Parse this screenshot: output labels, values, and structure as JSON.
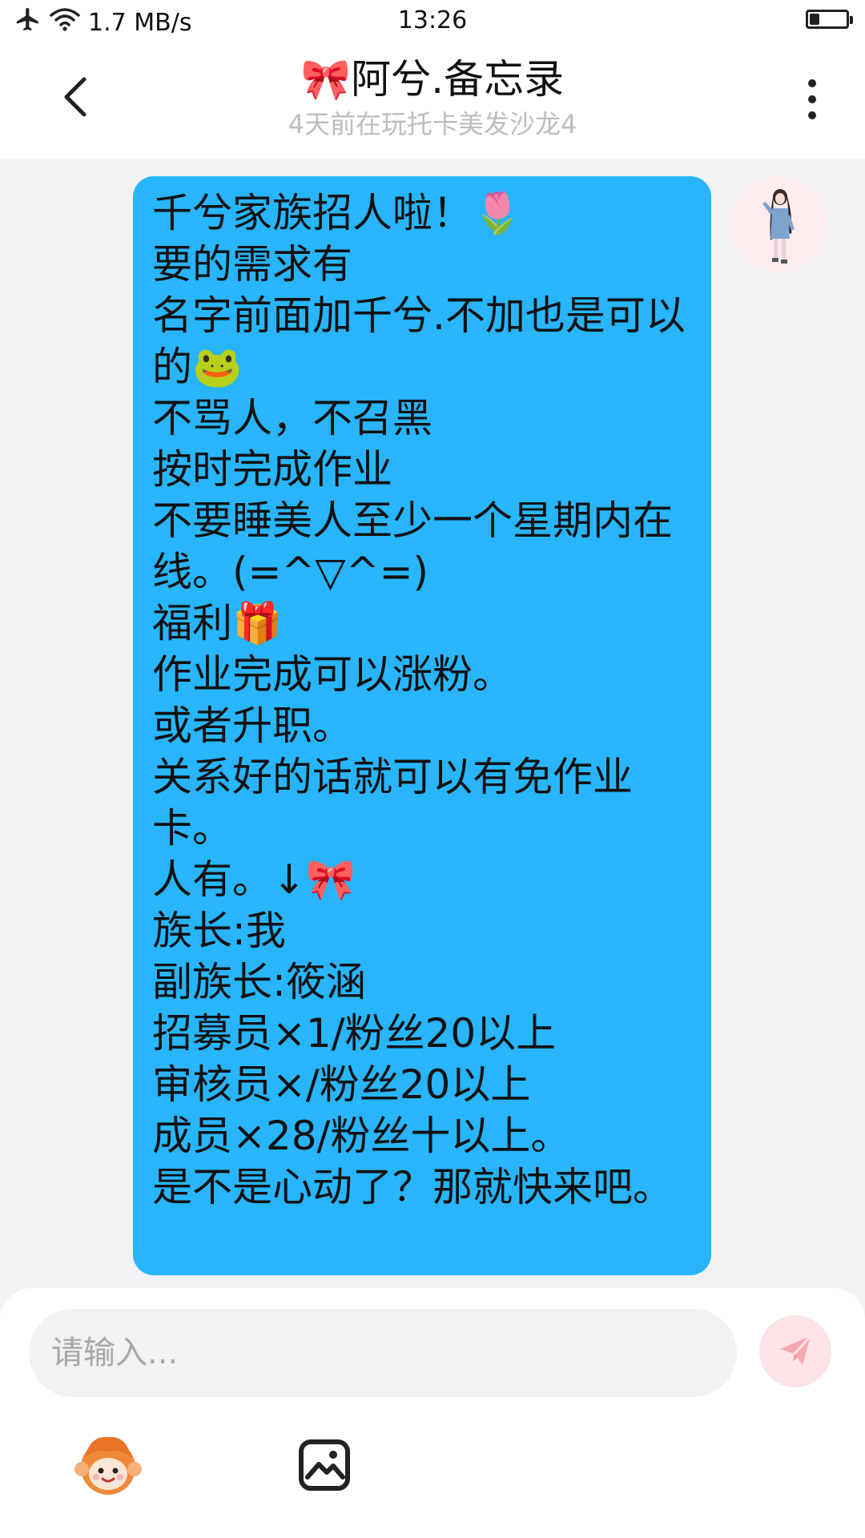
{
  "status_bar": {
    "network_speed": "1.7 MB/s",
    "time": "13:26"
  },
  "header": {
    "title": "🎀阿兮.备忘录",
    "subtitle": "4天前在玩托卡美发沙龙4"
  },
  "message": {
    "text": "千兮家族招人啦！🌷\n要的需求有\n名字前面加千兮.不加也是可以的🐸\n不骂人，不召黑\n按时完成作业\n不要睡美人至少一个星期内在线。(=^▽^=)\n福利🎁\n作业完成可以涨粉。\n或者升职。\n关系好的话就可以有免作业卡。\n人有。↓🎀\n族长:我\n副族长:筱涵\n招募员×1/粉丝20以上\n审核员×/粉丝20以上\n成员×28/粉丝十以上。\n是不是心动了？那就快来吧。"
  },
  "composer": {
    "placeholder": "请输入..."
  },
  "colors": {
    "bubble": "#28B5FB",
    "page_background": "#F2F2F5",
    "send_button_bg": "#FCE3E6",
    "send_icon": "#F7A9B2"
  },
  "icons": {
    "status": [
      "airplane-icon",
      "wifi-icon",
      "battery-icon"
    ],
    "header": [
      "back-arrow-icon",
      "more-vertical-icon"
    ],
    "composer": [
      "send-icon",
      "emoji-mascot-icon",
      "image-icon"
    ]
  }
}
